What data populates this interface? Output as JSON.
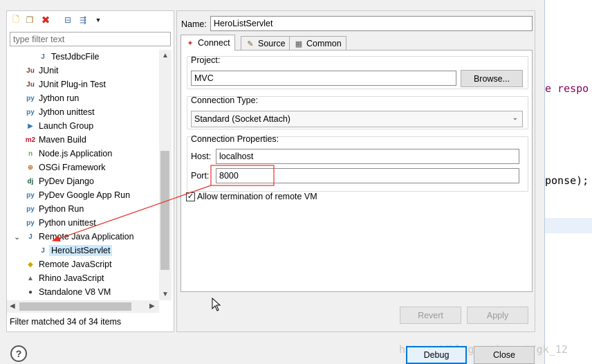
{
  "editor": {
    "line1": "e respo",
    "line2": "ponse);"
  },
  "left_panel": {
    "filter_placeholder": "type filter text",
    "filter_status": "Filter matched 34 of 34 items",
    "tree_items": [
      {
        "label": "TestJdbcFile",
        "icon": "J"
      },
      {
        "label": "JUnit",
        "icon": "Ju"
      },
      {
        "label": "JUnit Plug-in Test",
        "icon": "Ju"
      },
      {
        "label": "Jython run",
        "icon": "py"
      },
      {
        "label": "Jython unittest",
        "icon": "py"
      },
      {
        "label": "Launch Group",
        "icon": "▶"
      },
      {
        "label": "Maven Build",
        "icon": "m2"
      },
      {
        "label": "Node.js Application",
        "icon": "n"
      },
      {
        "label": "OSGi Framework",
        "icon": "⊕"
      },
      {
        "label": "PyDev Django",
        "icon": "dj"
      },
      {
        "label": "PyDev Google App Run",
        "icon": "py"
      },
      {
        "label": "Python Run",
        "icon": "py"
      },
      {
        "label": "Python unittest",
        "icon": "py"
      },
      {
        "label": "Remote Java Application",
        "icon": "J"
      },
      {
        "label": "HeroListServlet",
        "icon": "J"
      },
      {
        "label": "Remote JavaScript",
        "icon": "◆"
      },
      {
        "label": "Rhino JavaScript",
        "icon": "▲"
      },
      {
        "label": "Standalone V8 VM",
        "icon": "●"
      }
    ]
  },
  "config": {
    "name_label": "Name:",
    "name_value": "HeroListServlet",
    "tabs": [
      "Connect",
      "Source",
      "Common"
    ],
    "project_label": "Project:",
    "project_value": "MVC",
    "browse_label": "Browse...",
    "conn_type_label": "Connection Type:",
    "conn_type_value": "Standard (Socket Attach)",
    "conn_props_label": "Connection Properties:",
    "host_label": "Host:",
    "host_value": "localhost",
    "port_label": "Port:",
    "port_value": "8000",
    "allow_termination_label": "Allow termination of remote VM",
    "allow_termination_checked": true,
    "revert_label": "Revert",
    "apply_label": "Apply"
  },
  "footer": {
    "help": "?",
    "debug_label": "Debug",
    "close_label": "Close",
    "watermark": "https://blog.csdn.net/gk_12"
  },
  "annotation_color": "#e8302a"
}
